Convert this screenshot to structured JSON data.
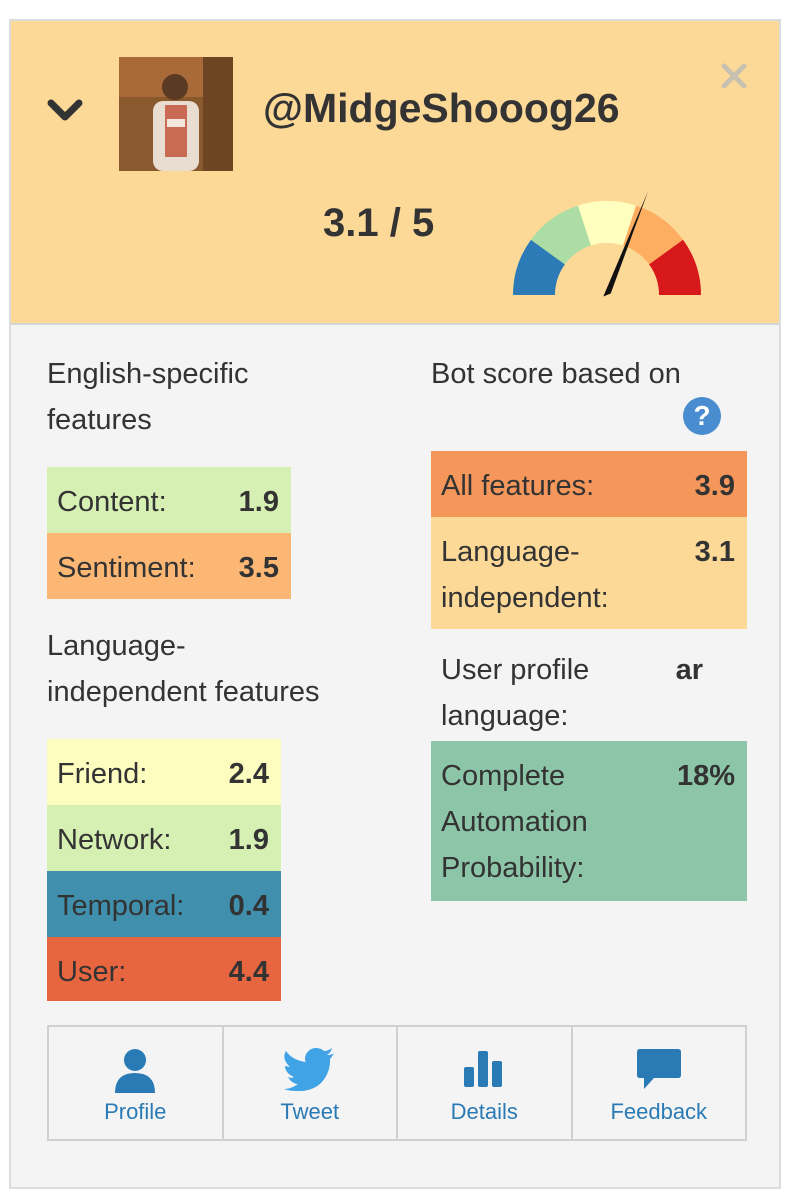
{
  "header": {
    "handle": "@MidgeShooog26",
    "score_text": "3.1 / 5",
    "score": 3.1,
    "score_max": 5
  },
  "english_section": {
    "title_line1": "English-specific",
    "title_line2": "features",
    "items": [
      {
        "label": "Content:",
        "value": "1.9",
        "color": "#d6efb3"
      },
      {
        "label": "Sentiment:",
        "value": "3.5",
        "color": "#fcb774"
      }
    ]
  },
  "language_section": {
    "title_line1": "Language-",
    "title_line2": "independent features",
    "items": [
      {
        "label": "Friend:",
        "value": "2.4",
        "color": "#fdfdbf"
      },
      {
        "label": "Network:",
        "value": "1.9",
        "color": "#d6efb3"
      },
      {
        "label": "Temporal:",
        "value": "0.4",
        "color": "#3f8fad"
      },
      {
        "label": "User:",
        "value": "4.4",
        "color": "#e8663f"
      }
    ]
  },
  "bot_section": {
    "title": "Bot score based on",
    "help_icon": "?",
    "all_features": {
      "label": "All features:",
      "value": "3.9",
      "color": "#f5975a"
    },
    "language_independent": {
      "label_line1": "Language-",
      "label_line2": "independent:",
      "value": "3.1",
      "color": "#fdd998"
    },
    "user_profile_language": {
      "label_line1": "User profile",
      "label_line2": "language:",
      "value": "ar"
    },
    "cap": {
      "label_line1": "Complete",
      "label_line2": "Automation",
      "label_line3": "Probability:",
      "value": "18%",
      "color": "#8cc5a8"
    }
  },
  "actions": [
    {
      "label": "Profile",
      "icon": "user-icon"
    },
    {
      "label": "Tweet",
      "icon": "twitter-bird-icon"
    },
    {
      "label": "Details",
      "icon": "bar-chart-icon"
    },
    {
      "label": "Feedback",
      "icon": "speech-bubble-icon"
    }
  ],
  "colors": {
    "header_bg": "#fdd998",
    "link": "#2a7ab5",
    "gauge": [
      "#2c7bb6",
      "#abdda4",
      "#ffffbf",
      "#fdae61",
      "#d7191c"
    ]
  }
}
